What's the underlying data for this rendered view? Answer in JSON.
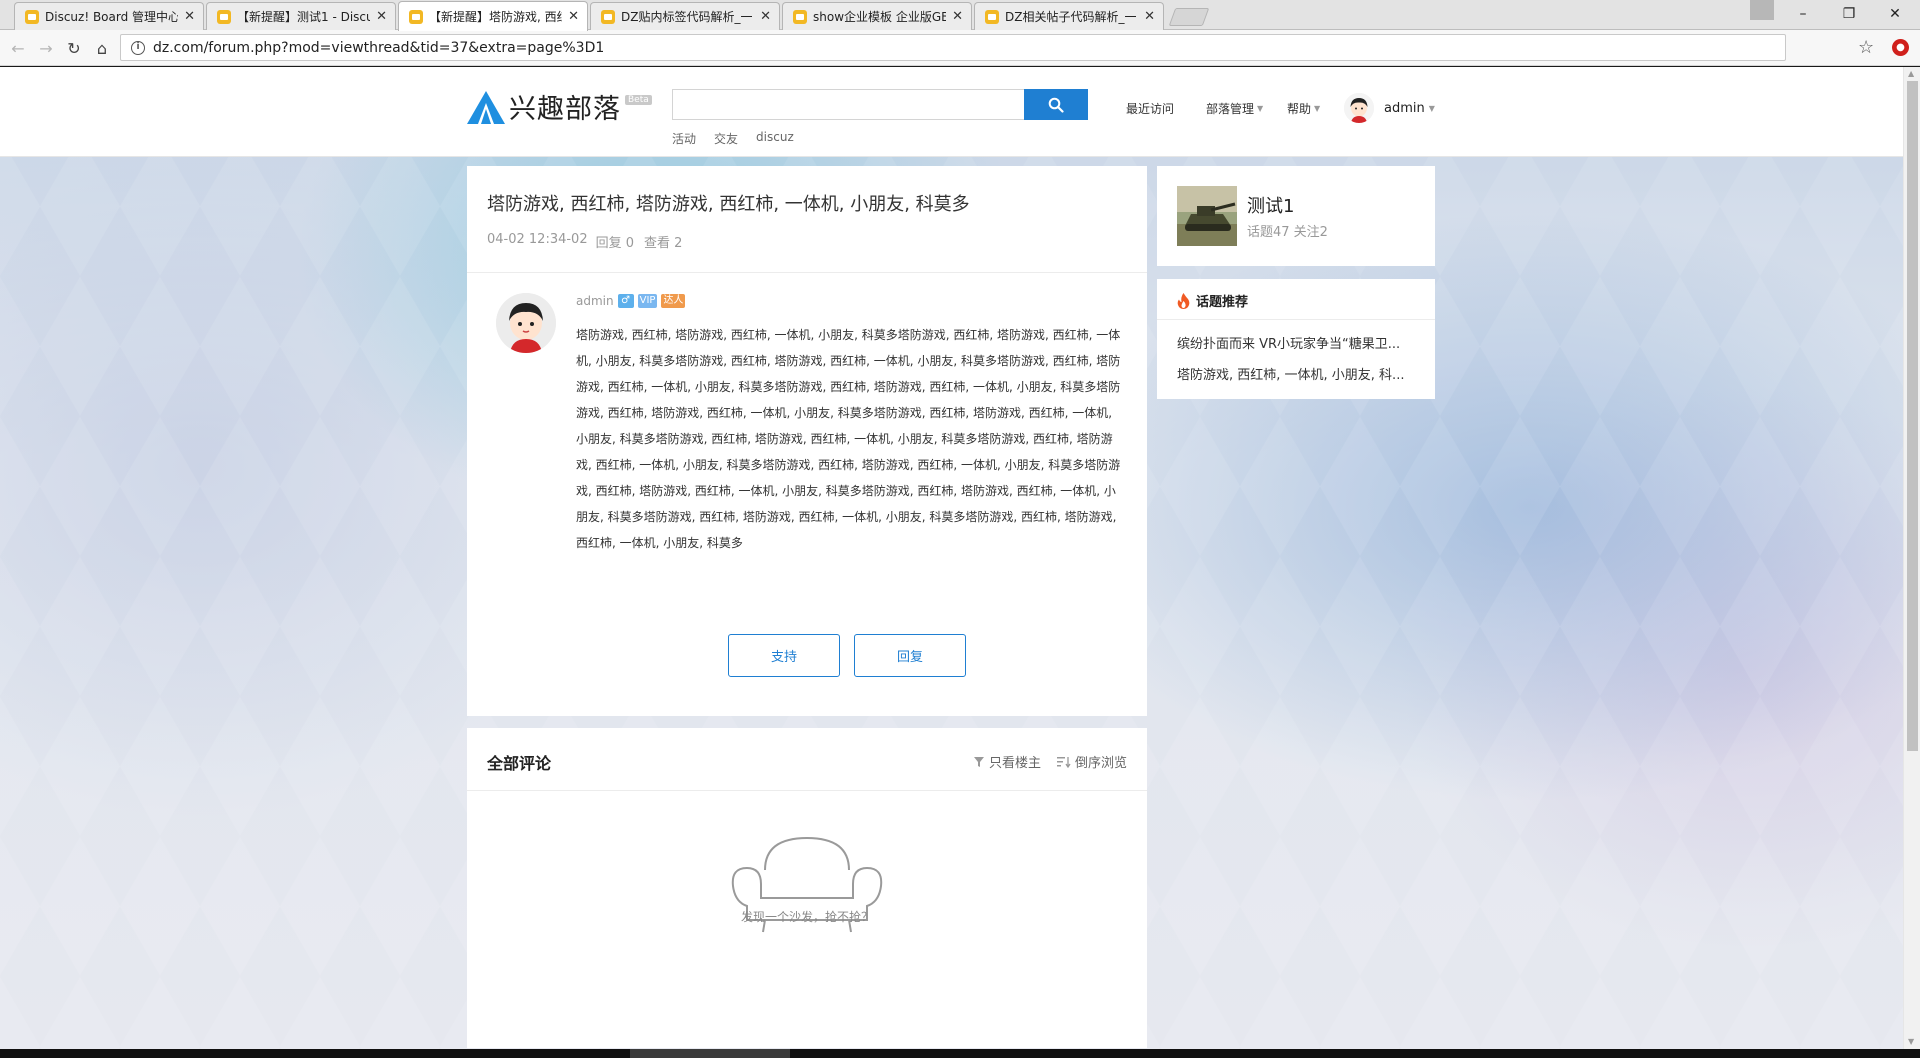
{
  "browser": {
    "tabs": [
      {
        "title": "Discuz! Board 管理中心"
      },
      {
        "title": "【新提醒】测试1 - Discu"
      },
      {
        "title": "【新提醒】塔防游戏, 西红"
      },
      {
        "title": "DZ贴内标签代码解析_一"
      },
      {
        "title": "show企业模板 企业版GB"
      },
      {
        "title": "DZ相关帖子代码解析_一"
      }
    ],
    "close_glyph": "✕",
    "url": "dz.com/forum.php?mod=viewthread&tid=37&extra=page%3D1"
  },
  "header": {
    "logo_text": "兴趣部落",
    "logo_badge": "Beta",
    "search_placeholder": "",
    "search_links": [
      "活动",
      "交友",
      "discuz"
    ],
    "nav": {
      "recent": "最近访问",
      "manage": "部落管理",
      "help": "帮助"
    },
    "user": "admin"
  },
  "thread": {
    "title": "塔防游戏, 西红柿, 塔防游戏, 西红柿, 一体机, 小朋友, 科莫多",
    "time": "04-02 12:34-02",
    "replies": "回复 0",
    "views": "查看 2",
    "author": "admin",
    "badge_gender": "♂",
    "badge_vip": "VIP",
    "badge_talent": "达人",
    "content": "塔防游戏, 西红柿, 塔防游戏, 西红柿, 一体机, 小朋友, 科莫多塔防游戏, 西红柿, 塔防游戏, 西红柿, 一体机, 小朋友, 科莫多塔防游戏, 西红柿, 塔防游戏, 西红柿, 一体机, 小朋友, 科莫多塔防游戏, 西红柿, 塔防游戏, 西红柿, 一体机, 小朋友, 科莫多塔防游戏, 西红柿, 塔防游戏, 西红柿, 一体机, 小朋友, 科莫多塔防游戏, 西红柿, 塔防游戏, 西红柿, 一体机, 小朋友, 科莫多塔防游戏, 西红柿, 塔防游戏, 西红柿, 一体机, 小朋友, 科莫多塔防游戏, 西红柿, 塔防游戏, 西红柿, 一体机, 小朋友, 科莫多塔防游戏, 西红柿, 塔防游戏, 西红柿, 一体机, 小朋友, 科莫多塔防游戏, 西红柿, 塔防游戏, 西红柿, 一体机, 小朋友, 科莫多塔防游戏, 西红柿, 塔防游戏, 西红柿, 一体机, 小朋友, 科莫多塔防游戏, 西红柿, 塔防游戏, 西红柿, 一体机, 小朋友, 科莫多塔防游戏, 西红柿, 塔防游戏, 西红柿, 一体机, 小朋友, 科莫多塔防游戏, 西红柿, 塔防游戏, 西红柿, 一体机, 小朋友, 科莫多",
    "support_label": "支持",
    "reply_label": "回复"
  },
  "comments": {
    "title": "全部评论",
    "only_owner": "只看楼主",
    "reverse": "倒序浏览",
    "empty_text": "发现一个沙发，抢不抢？"
  },
  "sidebar": {
    "group_name": "测试1",
    "group_stats": "话题47 关注2",
    "topics_title": "话题推荐",
    "topics": [
      "缤纷扑面而来 VR小玩家争当“糖果卫...",
      "塔防游戏, 西红柿, 一体机, 小朋友, 科..."
    ]
  },
  "colors": {
    "accent": "#1f7fd2",
    "favicon": "#f2b824"
  }
}
